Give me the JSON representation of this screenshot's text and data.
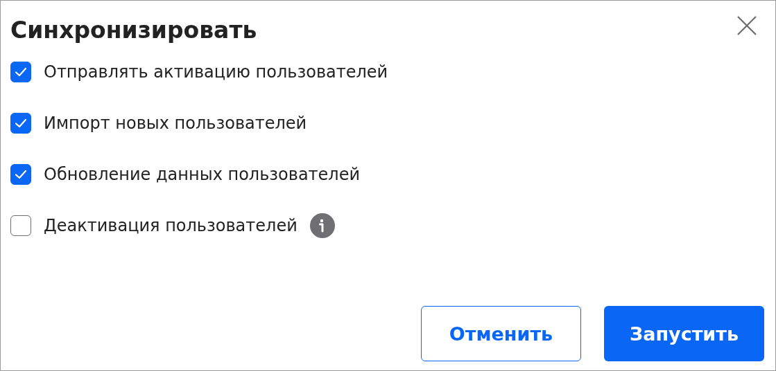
{
  "dialog": {
    "title": "Синхронизировать"
  },
  "options": [
    {
      "label": "Отправлять активацию пользователей",
      "checked": true,
      "info": false
    },
    {
      "label": "Импорт новых пользователей",
      "checked": true,
      "info": false
    },
    {
      "label": "Обновление данных пользователей",
      "checked": true,
      "info": false
    },
    {
      "label": "Деактивация пользователей",
      "checked": false,
      "info": true
    }
  ],
  "buttons": [
    {
      "label": "Отменить",
      "kind": "secondary"
    },
    {
      "label": "Запустить",
      "kind": "primary"
    }
  ]
}
